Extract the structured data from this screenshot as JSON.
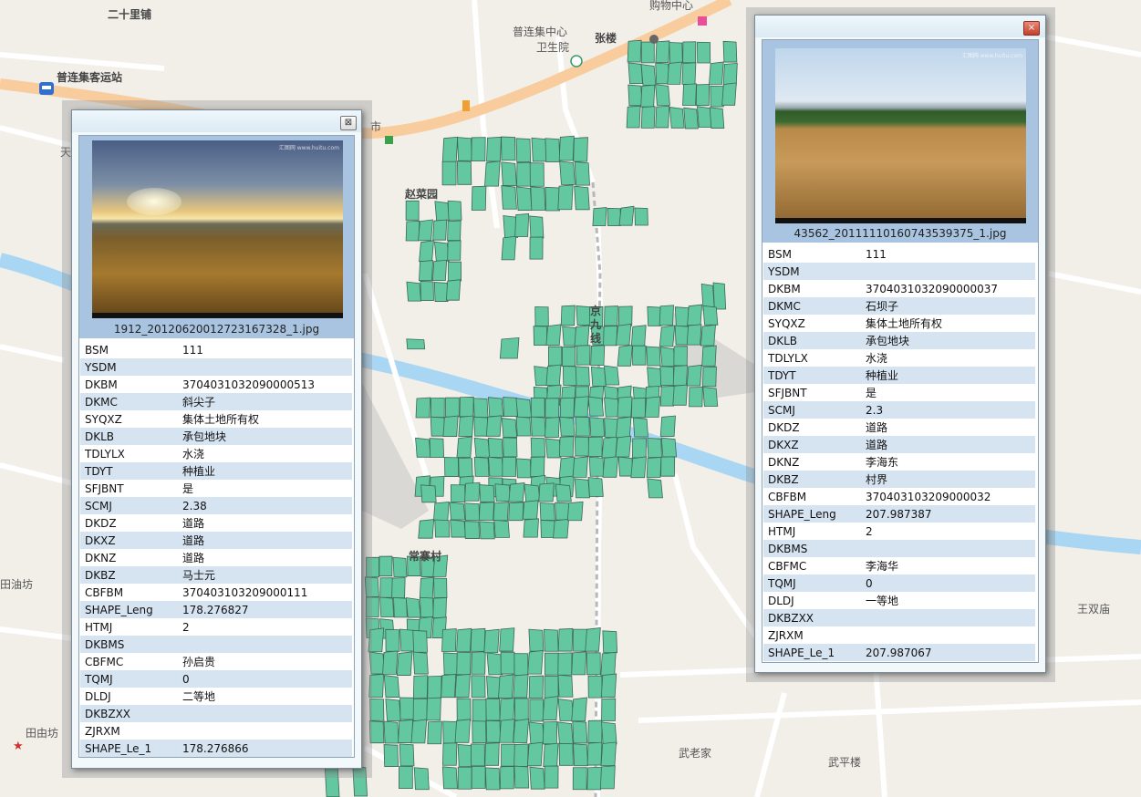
{
  "map": {
    "labels": {
      "ershilipu": "二十里铺",
      "puliancun_station": "普连集客运站",
      "puliancun_center": "普连集中心",
      "weishengyuan": "卫生院",
      "zhanglou": "张楼",
      "gouwuzhongxin": "购物中心",
      "zhaocaiyuan": "赵菜园",
      "jingjiuxian": "京九线",
      "changzhaicun": "常寨村",
      "tianyoufang": "田油坊",
      "tianyoufang2": "田由坊",
      "wanglaojia": "武老家",
      "wupinglou": "武平楼",
      "wangshuangmiao": "王双庙",
      "shi_fragment": "市",
      "tian_fragment": "天"
    },
    "colors": {
      "background": "#f2efe9",
      "road": "#ffffff",
      "main_road": "#f8cc9d",
      "river": "#a9d6f3",
      "parcel_fill": "#63c7a0",
      "parcel_stroke": "#3d6658"
    }
  },
  "popups": [
    {
      "image_caption": "1912_20120620012723167328_1.jpg",
      "watermark": "汇图网 www.huitu.com",
      "close_symbol": "⊠",
      "rows": [
        {
          "key": "BSM",
          "value": "111"
        },
        {
          "key": "YSDM",
          "value": ""
        },
        {
          "key": "DKBM",
          "value": "3704031032090000513"
        },
        {
          "key": "DKMC",
          "value": "斜尖子"
        },
        {
          "key": "SYQXZ",
          "value": "集体土地所有权"
        },
        {
          "key": "DKLB",
          "value": "承包地块"
        },
        {
          "key": "TDLYLX",
          "value": "水浇"
        },
        {
          "key": "TDYT",
          "value": "种植业"
        },
        {
          "key": "SFJBNT",
          "value": "是"
        },
        {
          "key": "SCMJ",
          "value": "2.38"
        },
        {
          "key": "DKDZ",
          "value": "道路"
        },
        {
          "key": "DKXZ",
          "value": "道路"
        },
        {
          "key": "DKNZ",
          "value": "道路"
        },
        {
          "key": "DKBZ",
          "value": "马士元"
        },
        {
          "key": "CBFBM",
          "value": "370403103209000111"
        },
        {
          "key": "SHAPE_Leng",
          "value": "178.276827"
        },
        {
          "key": "HTMJ",
          "value": "2"
        },
        {
          "key": "DKBMS",
          "value": ""
        },
        {
          "key": "CBFMC",
          "value": "孙启贵"
        },
        {
          "key": "TQMJ",
          "value": "0"
        },
        {
          "key": "DLDJ",
          "value": "二等地"
        },
        {
          "key": "DKBZXX",
          "value": ""
        },
        {
          "key": "ZJRXM",
          "value": ""
        },
        {
          "key": "SHAPE_Le_1",
          "value": "178.276866"
        }
      ]
    },
    {
      "image_caption": "43562_20111110160743539375_1.jpg",
      "watermark": "汇图网 www.huitu.com",
      "close_symbol": "×",
      "rows": [
        {
          "key": "BSM",
          "value": "111"
        },
        {
          "key": "YSDM",
          "value": ""
        },
        {
          "key": "DKBM",
          "value": "3704031032090000037"
        },
        {
          "key": "DKMC",
          "value": "石坝子"
        },
        {
          "key": "SYQXZ",
          "value": "集体土地所有权"
        },
        {
          "key": "DKLB",
          "value": "承包地块"
        },
        {
          "key": "TDLYLX",
          "value": "水浇"
        },
        {
          "key": "TDYT",
          "value": "种植业"
        },
        {
          "key": "SFJBNT",
          "value": "是"
        },
        {
          "key": "SCMJ",
          "value": "2.3"
        },
        {
          "key": "DKDZ",
          "value": "道路"
        },
        {
          "key": "DKXZ",
          "value": "道路"
        },
        {
          "key": "DKNZ",
          "value": "李海东"
        },
        {
          "key": "DKBZ",
          "value": "村界"
        },
        {
          "key": "CBFBM",
          "value": "370403103209000032"
        },
        {
          "key": "SHAPE_Leng",
          "value": "207.987387"
        },
        {
          "key": "HTMJ",
          "value": "2"
        },
        {
          "key": "DKBMS",
          "value": ""
        },
        {
          "key": "CBFMC",
          "value": "李海华"
        },
        {
          "key": "TQMJ",
          "value": "0"
        },
        {
          "key": "DLDJ",
          "value": "一等地"
        },
        {
          "key": "DKBZXX",
          "value": ""
        },
        {
          "key": "ZJRXM",
          "value": ""
        },
        {
          "key": "SHAPE_Le_1",
          "value": "207.987067"
        }
      ]
    }
  ]
}
